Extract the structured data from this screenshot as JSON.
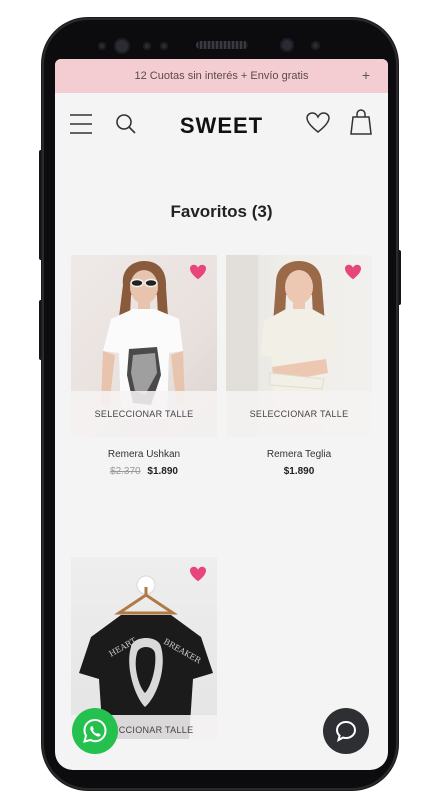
{
  "promo": {
    "text": "12 Cuotas sin interés + Envío gratis",
    "close": "+"
  },
  "header": {
    "logo": "SWEET"
  },
  "page": {
    "title": "Favoritos (3)"
  },
  "products": [
    {
      "name": "Remera Ushkan",
      "old_price": "$2.370",
      "price": "$1.890",
      "action": "SELECCIONAR TALLE"
    },
    {
      "name": "Remera Teglia",
      "old_price": "",
      "price": "$1.890",
      "action": "SELECCIONAR TALLE"
    },
    {
      "name": "",
      "old_price": "",
      "price": "",
      "action": "SELECCIONAR TALLE"
    }
  ],
  "colors": {
    "promo_bg": "#f4cdd2",
    "heart": "#e8457a",
    "whatsapp": "#25c14f",
    "chat": "#2d2f33"
  },
  "icons": [
    "menu-icon",
    "search-icon",
    "heart-icon",
    "bag-icon",
    "whatsapp-icon",
    "chat-icon"
  ]
}
